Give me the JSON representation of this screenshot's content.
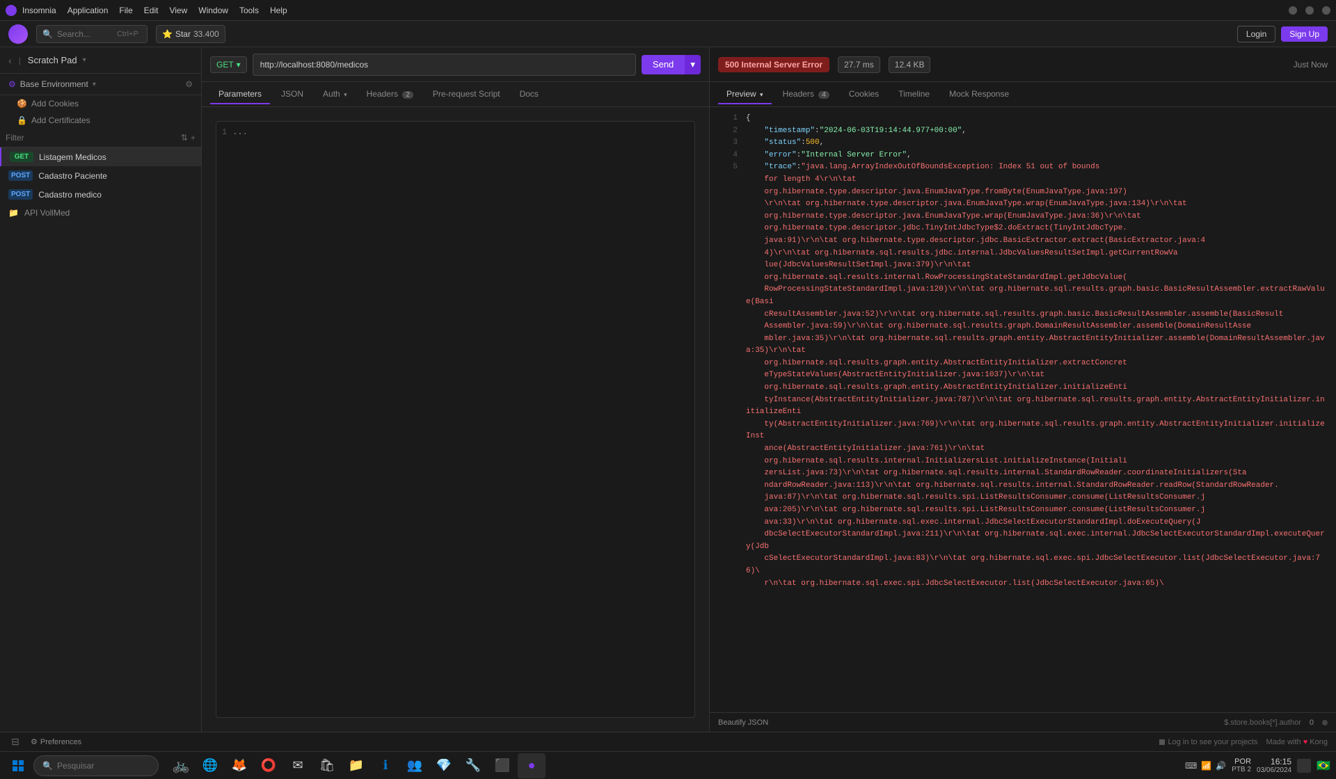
{
  "app": {
    "title": "Insomnia",
    "menu": [
      "Application",
      "File",
      "Edit",
      "View",
      "Window",
      "Tools",
      "Help"
    ]
  },
  "menubar": {
    "search_placeholder": "Search...",
    "search_shortcut": "Ctrl+P",
    "star_label": "Star",
    "star_count": "33.400",
    "login_label": "Login",
    "signup_label": "Sign Up"
  },
  "sidebar": {
    "scratch_pad_label": "Scratch Pad",
    "env_label": "Base Environment",
    "add_cookies": "Add Cookies",
    "add_certs": "Add Certificates",
    "filter_placeholder": "Filter",
    "items": [
      {
        "method": "GET",
        "name": "Listagem Medicos",
        "active": true
      },
      {
        "method": "POST",
        "name": "Cadastro Paciente"
      },
      {
        "method": "POST",
        "name": "Cadastro medico"
      }
    ],
    "folders": [
      {
        "name": "API VollMed"
      }
    ]
  },
  "request": {
    "method": "GET",
    "url": "http://localhost:8080/medicos",
    "send_label": "Send",
    "tabs": [
      {
        "label": "Parameters",
        "badge": null
      },
      {
        "label": "JSON",
        "badge": null
      },
      {
        "label": "Auth",
        "badge": null
      },
      {
        "label": "Headers",
        "badge": "2"
      },
      {
        "label": "Pre-request Script",
        "badge": null
      },
      {
        "label": "Docs",
        "badge": null
      }
    ],
    "active_tab": "Parameters",
    "body_line": "1",
    "body_content": "..."
  },
  "response": {
    "status": "500 Internal Server Error",
    "time_ms": "27.7 ms",
    "size_kb": "12.4 KB",
    "timestamp": "Just Now",
    "tabs": [
      {
        "label": "Preview",
        "badge": null
      },
      {
        "label": "Headers",
        "badge": "4"
      },
      {
        "label": "Cookies",
        "badge": null
      },
      {
        "label": "Timeline",
        "badge": null
      },
      {
        "label": "Mock Response",
        "badge": null
      }
    ],
    "active_tab": "Preview",
    "json_content": [
      {
        "ln": "1",
        "text": "{",
        "type": "brace"
      },
      {
        "ln": "2",
        "text": "\"timestamp\": \"2024-06-03T19:14:44.977+00:00\",",
        "key": "timestamp",
        "value": "2024-06-03T19:14:44.977+00:00"
      },
      {
        "ln": "3",
        "text": "\"status\": 500,",
        "key": "status",
        "value": "500"
      },
      {
        "ln": "4",
        "text": "\"error\": \"Internal Server Error\",",
        "key": "error",
        "value": "Internal Server Error"
      },
      {
        "ln": "5",
        "text": "\"trace\": \"java.lang.ArrayIndexOutOfBoundsException: Index 51 out of bounds for length 4\\r\\n\\tat org.hibernate.type.descriptor.java.EnumJavaType.fromByte(EnumJavaType.java:197)\\r\\n\\tat org.hibernate.type.descriptor.java.EnumJavaType.wrap(EnumJavaType.java:134)\\r\\n\\tat org.hibernate.type.descriptor.java.EnumJavaType.wrap(EnumJavaType.java:36)\\r\\n\\tat org.hibernate.type.descriptor.jdbc.TinyIntJdbcType$2.doExtract(TinyIntJdbcType.java:91)\\r\\n\\tat org.hibernate.type.descriptor.jdbc.BasicExtractor.extract(BasicExtractor.java:44)\\r\\n\\tat org.hibernate.sql.results.jdbc.internal.JdbcValuesResultSetImpl.getCurrentRowValue(JdbcValuesResultSetImpl.java:379)\\r\\n\\tat org.hibernate.sql.results.internal.RowProcessingStateStandardImpl.getJdbcValue(RowProcessingStateStandardImpl.java:120)\\r\\n\\tat org.hibernate.sql.results.graph.basic.BasicResultAssembler.extractRawValue(BasicResultAssembler.java:52)\\r\\n\\tat org.hibernate.sql.results.graph.basic.BasicResultAssembler.assemble(BasicResultAssembler.java:59)\\r\\n\\tat org.hibernate.sql.results.graph.DomainResultAssembler.assemble(DomainResultAssembler.java:35)\\r\\n\\tat org.hibernate.sql.results.graph.entity.AbstractEntityInitializer.extractConcreteTypeStateValues(AbstractEntityInitializer.java:1037)\\r\\n\\tat org.hibernate.sql.results.graph.entity.AbstractEntityInitializer.initializeEntityInstance(AbstractEntityInitializer.java:787)\\r\\n\\tat org.hibernate.sql.results.graph.entity.AbstractEntityInitializer.initializeEntity(AbstractEntityInitializer.java:769)\\r\\n\\tat org.hibernate.sql.results.graph.entity.AbstractEntityInitializer.initializeInstance(AbstractEntityInitializer.java:761)\\r\\n\\tat org.hibernate.sql.results.internal.InitializersList.initializeInstance(InitializersList.java:73)\\r\\n\\tat org.hibernate.sql.results.internal.StandardRowReader.coordinateInitializers(StandardRowReader.java:113)\\r\\n\\tat org.hibernate.sql.results.internal.StandardRowReader.readRow(StandardRowReader.java:87)\\r\\n\\tat org.hibernate.sql.results.spi.ListResultsConsumer.consume(ListResultsConsumer.java:205)\\r\\n\\tat org.hibernate.sql.results.spi.ListResultsConsumer.consume(ListResultsConsumer.java:33)\\r\\n\\tat org.hibernate.sql.exec.internal.JdbcSelectExecutorStandardImpl.doExecuteQuery(JdbcSelectExecutorStandardImpl.java:211)\\r\\n\\tat org.hibernate.sql.exec.internal.JdbcSelectExecutorStandardImpl.executeQuery(JdbcSelectExecutorStandardImpl.java:83)\\r\\n\\tat org.hibernate.sql.exec.spi.JdbcSelectExecutor.list(JdbcSelectExecutor.java:76)\\r\\n\\tat org.hibernate.sql.exec.spi.JdbcSelectExecutor.list(JdbcSelectExecutor.java:65)\\"
      }
    ],
    "beautify_label": "Beautify JSON",
    "footer_path": "$.store.books[*].author",
    "footer_num": "0"
  },
  "bottombar": {
    "prefs_label": "Preferences",
    "login_text": "Log in to see your projects",
    "made_with": "Made with",
    "kong_label": "Kong"
  },
  "taskbar": {
    "search_placeholder": "Pesquisar",
    "time": "16:15",
    "date": "03/06/2024",
    "language": "POR",
    "layout": "PTB 2"
  }
}
